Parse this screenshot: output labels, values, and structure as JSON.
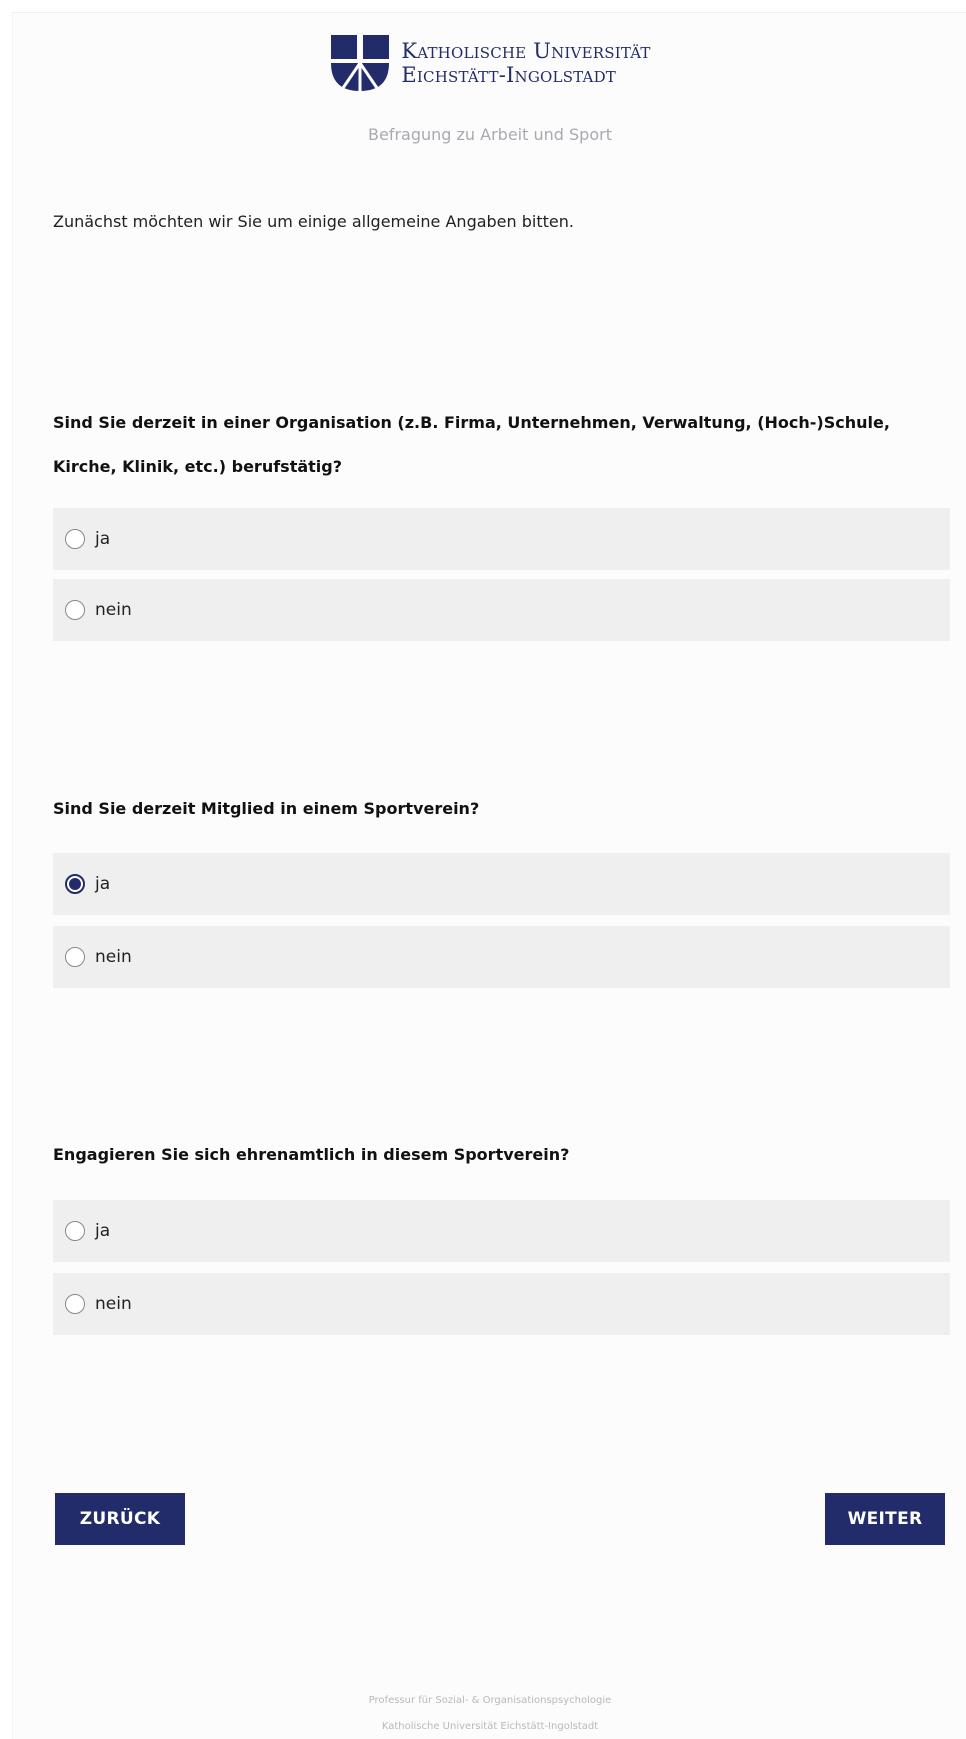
{
  "header": {
    "university_line1": "Katholische Universität",
    "university_line2": "Eichstätt-Ingolstadt",
    "subtitle": "Befragung zu Arbeit und Sport"
  },
  "intro": "Zunächst möchten wir Sie um einige allgemeine Angaben bitten.",
  "questions": [
    {
      "text": "Sind Sie derzeit in einer Organisation (z.B. Firma, Unternehmen, Verwaltung, (Hoch-)Schule, Kirche, Klinik, etc.) berufstätig?",
      "options": [
        "ja",
        "nein"
      ],
      "selected": null
    },
    {
      "text": "Sind Sie derzeit Mitglied in einem Sportverein?",
      "options": [
        "ja",
        "nein"
      ],
      "selected": "ja"
    },
    {
      "text": "Engagieren Sie sich ehrenamtlich in diesem Sportverein?",
      "options": [
        "ja",
        "nein"
      ],
      "selected": null
    }
  ],
  "buttons": {
    "back": "ZURÜCK",
    "next": "WEITER"
  },
  "footer": {
    "line1": "Professur für Sozial- & Organisationspsychologie",
    "line2": "Katholische Universität Eichstätt-Ingolstadt"
  },
  "colors": {
    "brand": "#222c6a",
    "option_bg": "#efefef",
    "subtitle": "#a9aab0"
  }
}
